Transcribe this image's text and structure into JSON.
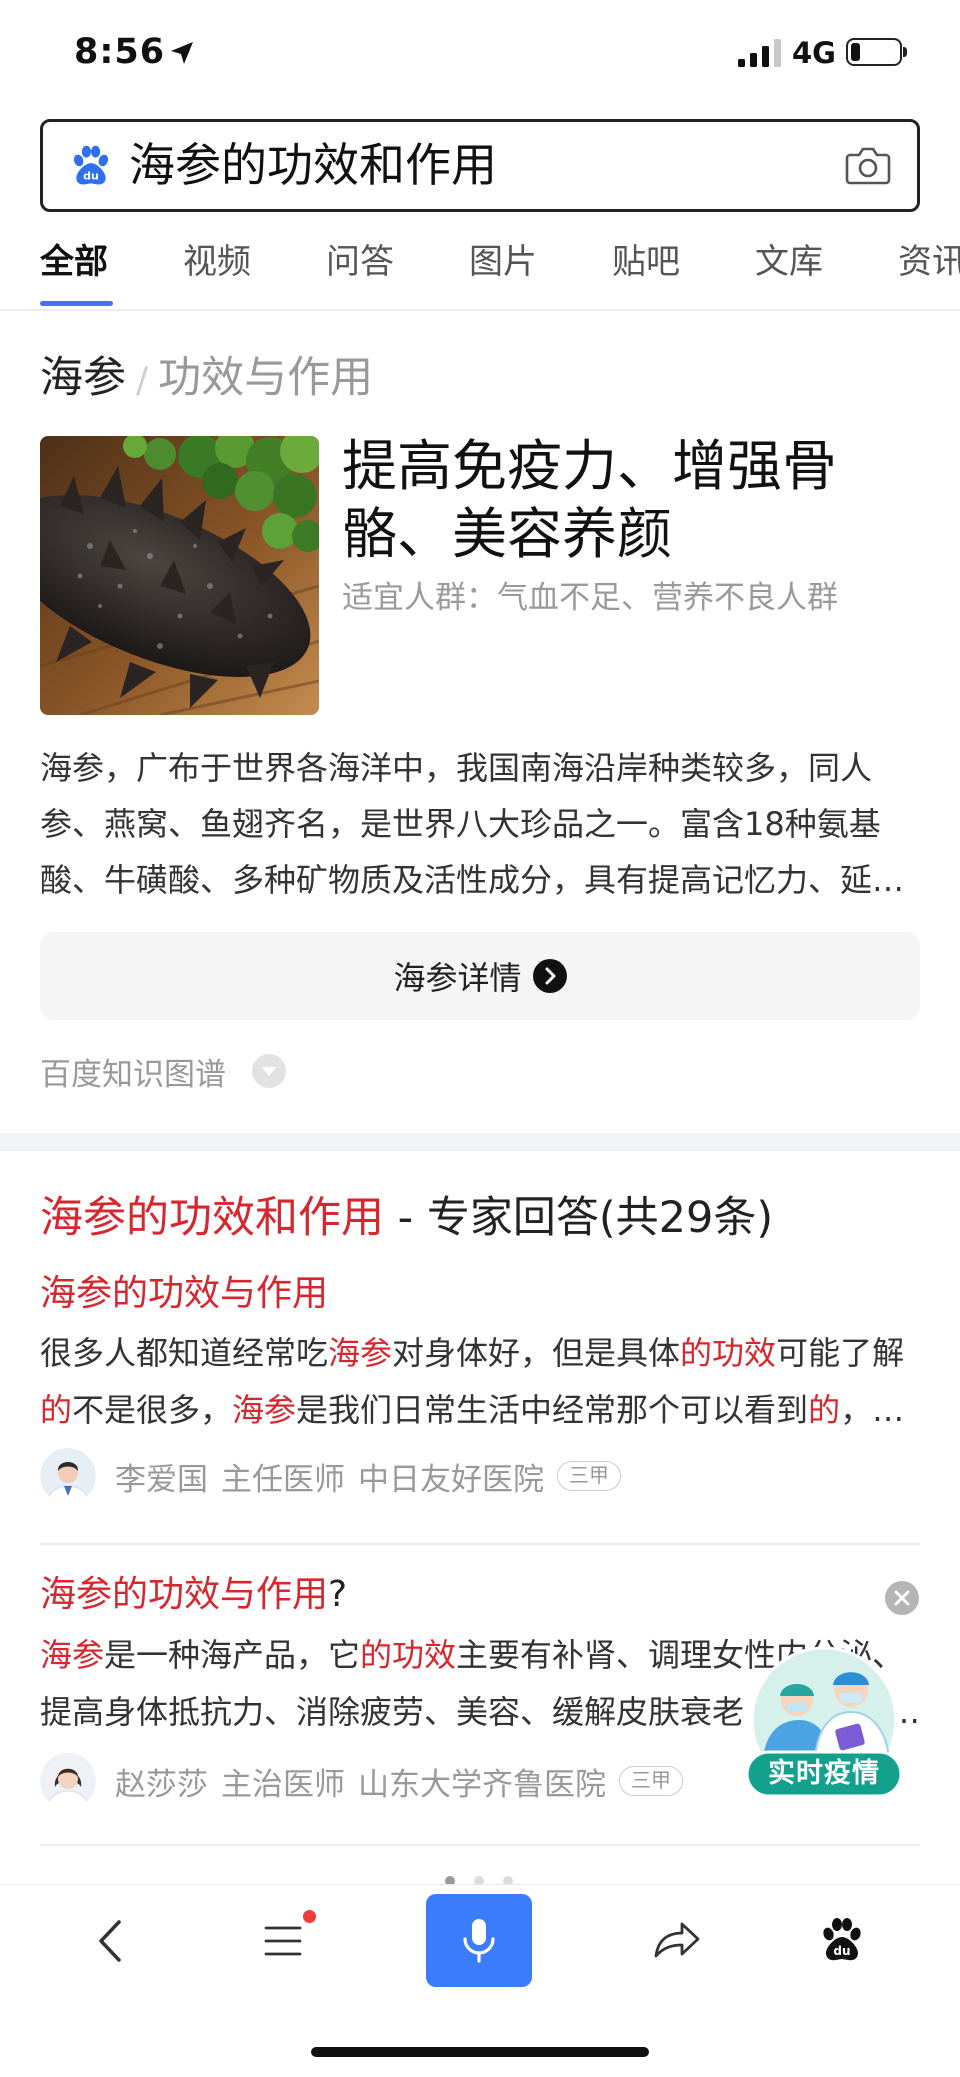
{
  "status_bar": {
    "time": "8:56",
    "network": "4G",
    "signal_strength": 3,
    "signal_max": 4,
    "battery_level": 0.2,
    "icons": [
      "location-arrow-icon",
      "signal-icon",
      "battery-icon"
    ]
  },
  "search": {
    "query": "海参的功效和作用",
    "logo_icon": "baidu-paw-icon",
    "logo_text": "du",
    "camera_icon": "camera-icon"
  },
  "tabs": [
    {
      "label": "全部",
      "active": true
    },
    {
      "label": "视频",
      "active": false
    },
    {
      "label": "问答",
      "active": false
    },
    {
      "label": "图片",
      "active": false
    },
    {
      "label": "贴吧",
      "active": false
    },
    {
      "label": "文库",
      "active": false
    },
    {
      "label": "资讯",
      "active": false
    }
  ],
  "knowledge_card": {
    "entity": "海参",
    "separator": "/",
    "topic": "功效与作用",
    "headline_lines": [
      "提高免疫力、增强骨",
      "骼、美容养颜"
    ],
    "suitable_people": "适宜人群：气血不足、营养不良人群",
    "description_lines": [
      "海参，广布于世界各海洋中，我国南海沿岸种类较多，同人",
      "参、燕窝、鱼翅齐名，是世界八大珍品之一。富含18种氨基",
      "酸、牛磺酸、多种矿物质及活性成分，具有提高记忆力、延…"
    ],
    "details_button": "海参详情",
    "source": "百度知识图谱",
    "icons": {
      "details_arrow": "chevron-right-circle-icon",
      "expand": "chevron-down-circle-icon"
    }
  },
  "expert_answers": {
    "title": [
      {
        "t": "海参的功效和作用",
        "hl": true
      },
      {
        "t": " - 专家回答(共29条)",
        "hl": false
      }
    ],
    "items": [
      {
        "question": [
          {
            "t": "海参的功效与作用",
            "hl": true
          }
        ],
        "lines": [
          [
            {
              "t": "很多人都知道经常吃",
              "hl": false
            },
            {
              "t": "海参",
              "hl": true
            },
            {
              "t": "对身体好，但是具体",
              "hl": false
            },
            {
              "t": "的功效",
              "hl": true
            },
            {
              "t": "可能了解",
              "hl": false
            }
          ],
          [
            {
              "t": "的",
              "hl": true
            },
            {
              "t": "不是很多，",
              "hl": false
            },
            {
              "t": "海参",
              "hl": true
            },
            {
              "t": "是我们日常生活中经常那个可以看到",
              "hl": false
            },
            {
              "t": "的",
              "hl": true
            },
            {
              "t": "，…",
              "hl": false
            }
          ]
        ],
        "doctor": {
          "name": "李爱国",
          "title": "主任医师",
          "hospital": "中日友好医院",
          "grade": "三甲"
        }
      },
      {
        "question": [
          {
            "t": "海参的功效与作用",
            "hl": true
          },
          {
            "t": "?",
            "hl": false
          }
        ],
        "lines": [
          [
            {
              "t": "海参",
              "hl": true
            },
            {
              "t": "是一种海产品，它",
              "hl": false
            },
            {
              "t": "的功效",
              "hl": true
            },
            {
              "t": "主要有补肾、调理女性内分泌、",
              "hl": false
            }
          ],
          [
            {
              "t": "提高身体抵抗力、消除疲劳、美容、缓解皮肤衰老",
              "hl": false
            },
            {
              "t": "…",
              "hl": false
            }
          ]
        ],
        "doctor": {
          "name": "赵莎莎",
          "title": "主治医师",
          "hospital": "山东大学齐鲁医院",
          "grade": "三甲"
        },
        "dismiss_icon": "close-icon"
      }
    ]
  },
  "carousel_dots": {
    "count": 3,
    "active_index": 0
  },
  "floating_badge": {
    "label": "实时疫情",
    "icon": "doctors-illustration-icon"
  },
  "bottom_nav": {
    "items": [
      {
        "icon": "back-chevron-icon"
      },
      {
        "icon": "menu-icon",
        "notification_dot": true
      },
      {
        "icon": "microphone-icon"
      },
      {
        "icon": "share-icon"
      },
      {
        "icon": "baidu-paw-icon",
        "logo_text": "du"
      }
    ]
  },
  "colors": {
    "highlight_red": "#d7262e",
    "tab_active_blue": "#4e6ef2",
    "mic_button_blue": "#3a7cfb",
    "logo_blue": "#2f6ff0",
    "secondary_text_gray": "#999999",
    "badge_teal": "#13a08c"
  }
}
